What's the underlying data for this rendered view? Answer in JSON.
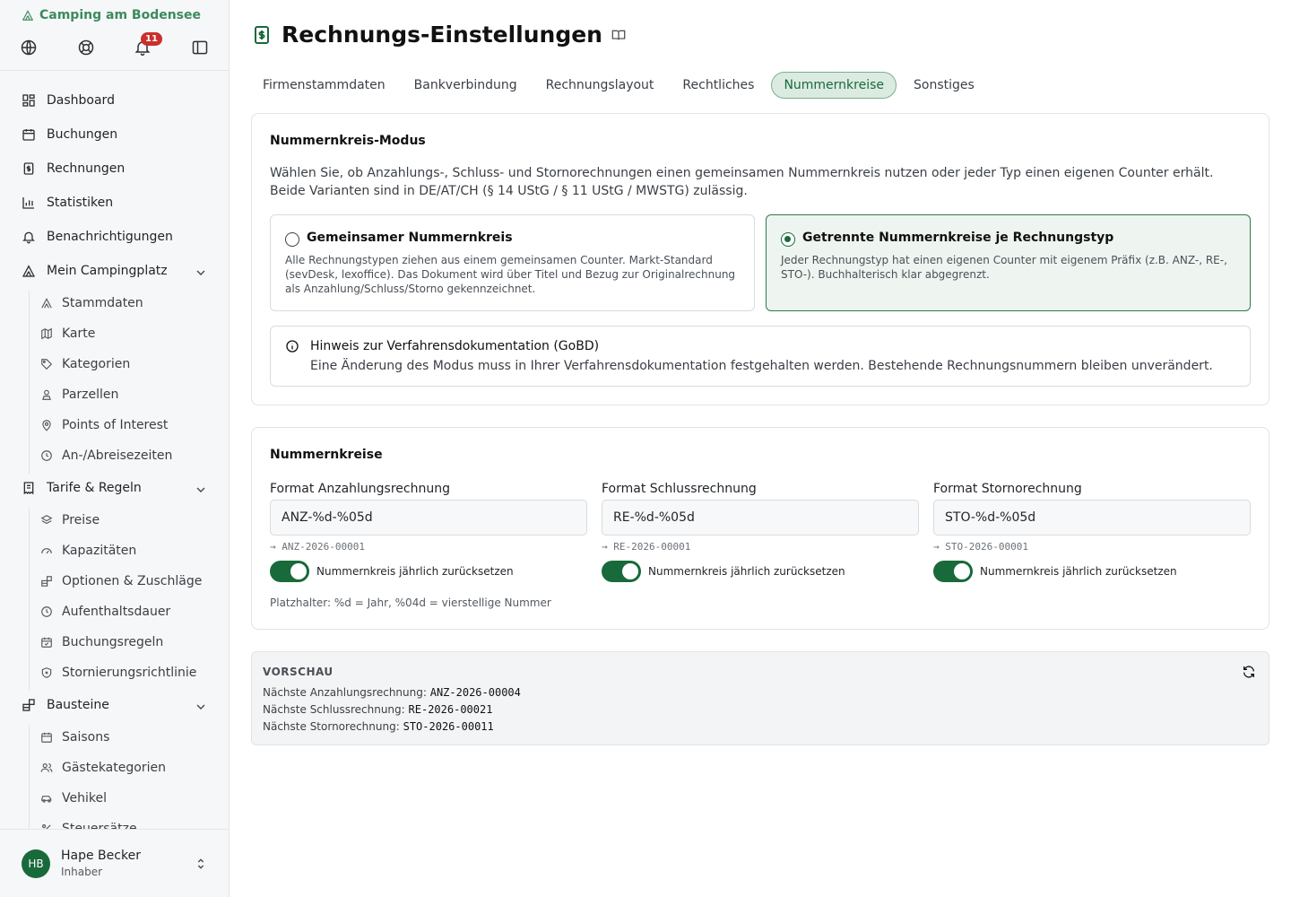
{
  "brand": {
    "name": "Camping am Bodensee"
  },
  "notifications": {
    "count": "11"
  },
  "nav": {
    "dashboard": "Dashboard",
    "buchungen": "Buchungen",
    "rechnungen": "Rechnungen",
    "statistiken": "Statistiken",
    "benachrichtigungen": "Benachrichtigungen",
    "mein_campingplatz": "Mein Campingplatz",
    "mein_sub": [
      "Stammdaten",
      "Karte",
      "Kategorien",
      "Parzellen",
      "Points of Interest",
      "An-/Abreisezeiten"
    ],
    "tarife": "Tarife & Regeln",
    "tarife_sub": [
      "Preise",
      "Kapazitäten",
      "Optionen & Zuschläge",
      "Aufenthaltsdauer",
      "Buchungsregeln",
      "Stornierungsrichtlinie"
    ],
    "bausteine": "Bausteine",
    "bausteine_sub": [
      "Saisons",
      "Gästekategorien",
      "Vehikel",
      "Steuersätze"
    ]
  },
  "user": {
    "initials": "HB",
    "name": "Hape Becker",
    "role": "Inhaber"
  },
  "page": {
    "title": "Rechnungs-Einstellungen"
  },
  "tabs": [
    "Firmenstammdaten",
    "Bankverbindung",
    "Rechnungslayout",
    "Rechtliches",
    "Nummernkreise",
    "Sonstiges"
  ],
  "mode": {
    "title": "Nummernkreis-Modus",
    "desc1": "Wählen Sie, ob Anzahlungs-, Schluss- und Stornorechnungen einen gemeinsamen Nummernkreis nutzen oder jeder Typ einen eigenen Counter erhält.",
    "desc2": "Beide Varianten sind in DE/AT/CH (§ 14 UStG / § 11 UStG / MWSTG) zulässig.",
    "option_shared": {
      "title": "Gemeinsamer Nummernkreis",
      "desc": "Alle Rechnungstypen ziehen aus einem gemeinsamen Counter. Markt-Standard (sevDesk, lexoffice). Das Dokument wird über Titel und Bezug zur Originalrechnung als Anzahlung/Schluss/Storno gekennzeichnet."
    },
    "option_separate": {
      "title": "Getrennte Nummernkreise je Rechnungstyp",
      "desc": "Jeder Rechnungstyp hat einen eigenen Counter mit eigenem Präfix (z.B. ANZ-, RE-, STO-). Buchhalterisch klar abgegrenzt."
    },
    "hint_title": "Hinweis zur Verfahrensdokumentation (GoBD)",
    "hint_text": "Eine Änderung des Modus muss in Ihrer Verfahrensdokumentation festgehalten werden. Bestehende Rechnungsnummern bleiben unverändert."
  },
  "ranges": {
    "title": "Nummernkreise",
    "anzahlung": {
      "label": "Format Anzahlungsrechnung",
      "value": "ANZ-%d-%05d",
      "preview": "→ ANZ-2026-00001",
      "toggle": "Nummernkreis jährlich zurücksetzen"
    },
    "schluss": {
      "label": "Format Schlussrechnung",
      "value": "RE-%d-%05d",
      "preview": "→ RE-2026-00001",
      "toggle": "Nummernkreis jährlich zurücksetzen"
    },
    "storno": {
      "label": "Format Stornorechnung",
      "value": "STO-%d-%05d",
      "preview": "→ STO-2026-00001",
      "toggle": "Nummernkreis jährlich zurücksetzen"
    },
    "placeholder_note": "Platzhalter: %d = Jahr, %04d = vierstellige Nummer"
  },
  "preview": {
    "heading": "VORSCHAU",
    "anz_label": "Nächste Anzahlungsrechnung:",
    "anz_value": "ANZ-2026-00004",
    "re_label": "Nächste Schlussrechnung:",
    "re_value": "RE-2026-00021",
    "sto_label": "Nächste Stornorechnung:",
    "sto_value": "STO-2026-00011"
  },
  "colors": {
    "accent": "#186a3a",
    "brand": "#3c8a5e",
    "badge": "#c9302c"
  }
}
